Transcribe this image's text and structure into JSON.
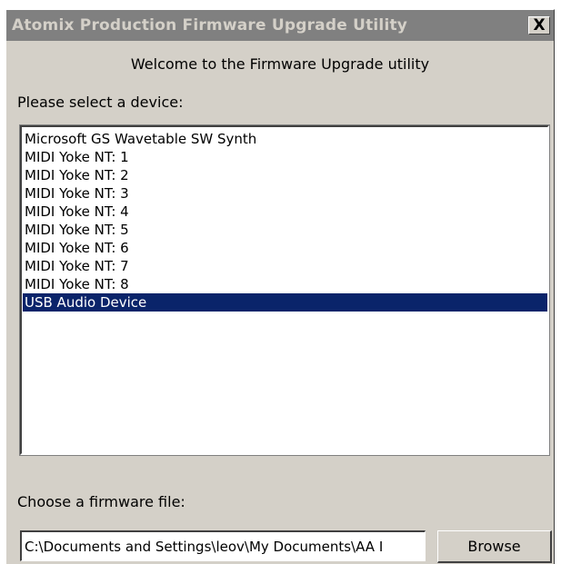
{
  "window": {
    "title": "Atomix Production Firmware Upgrade Utility",
    "close_label": "X"
  },
  "welcome_text": "Welcome to the Firmware Upgrade utility",
  "device_select": {
    "label": "Please select a device:",
    "items": [
      "Microsoft GS Wavetable SW Synth",
      "MIDI Yoke NT:  1",
      "MIDI Yoke NT:  2",
      "MIDI Yoke NT:  3",
      "MIDI Yoke NT:  4",
      "MIDI Yoke NT:  5",
      "MIDI Yoke NT:  6",
      "MIDI Yoke NT:  7",
      "MIDI Yoke NT:  8",
      "USB Audio Device"
    ],
    "selected": "USB Audio Device"
  },
  "firmware": {
    "label": "Choose a firmware file:",
    "path_value": "C:\\Documents and Settings\\leov\\My Documents\\AA I",
    "browse_label": "Browse"
  },
  "colors": {
    "titlebar_inactive": "#808080",
    "dialog_face": "#d4d0c8",
    "selection": "#0a246a"
  }
}
